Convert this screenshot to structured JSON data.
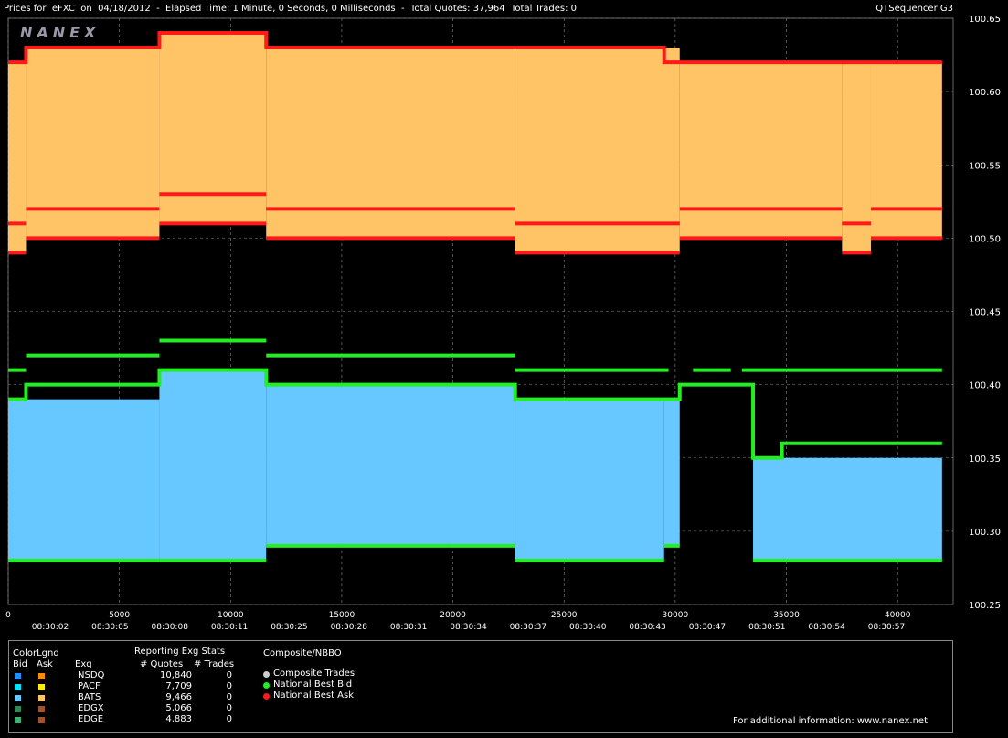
{
  "header": {
    "title": "Prices for  eFXC  on  04/18/2012  -  Elapsed Time: 1 Minute, 0 Seconds, 0 Milliseconds  -  Total Quotes: 37,964  Total Trades: 0",
    "app": "QTSequencer G3"
  },
  "logo": "NANEX",
  "colors": {
    "ask_fill": "#ffc466",
    "bid_fill": "#66c8ff",
    "ask_line": "#ff1a1a",
    "bid_line": "#22ee22",
    "grid": "#888888"
  },
  "chart_data": {
    "type": "line",
    "ylim": [
      100.25,
      100.65
    ],
    "xlim": [
      0,
      42500
    ],
    "y_ticks": [
      "100.25",
      "100.30",
      "100.35",
      "100.40",
      "100.45",
      "100.50",
      "100.55",
      "100.60",
      "100.65"
    ],
    "x_ticks": [
      "0",
      "5000",
      "10000",
      "15000",
      "20000",
      "25000",
      "30000",
      "35000",
      "40000"
    ],
    "time_labels": [
      "08:30:02",
      "08:30:05",
      "08:30:08",
      "08:30:11",
      "08:30:25",
      "08:30:28",
      "08:30:31",
      "08:30:34",
      "08:30:37",
      "08:30:40",
      "08:30:43",
      "08:30:47",
      "08:30:51",
      "08:30:54",
      "08:30:57"
    ],
    "series": [
      {
        "name": "National Best Ask",
        "points": [
          [
            0,
            100.62
          ],
          [
            800,
            100.63
          ],
          [
            6800,
            100.64
          ],
          [
            11600,
            100.63
          ],
          [
            29500,
            100.62
          ],
          [
            42000,
            100.62
          ]
        ]
      },
      {
        "name": "National Best Bid",
        "points": [
          [
            0,
            100.39
          ],
          [
            800,
            100.4
          ],
          [
            6800,
            100.41
          ],
          [
            11600,
            100.4
          ],
          [
            22800,
            100.39
          ],
          [
            30200,
            100.4
          ],
          [
            33500,
            100.35
          ],
          [
            34800,
            100.36
          ],
          [
            42000,
            100.36
          ]
        ]
      }
    ],
    "ask_levels": [
      [
        0,
        800,
        100.51
      ],
      [
        800,
        6800,
        100.52
      ],
      [
        6800,
        11600,
        100.53
      ],
      [
        11600,
        22800,
        100.52
      ],
      [
        22800,
        30200,
        100.51
      ],
      [
        30200,
        37500,
        100.52
      ],
      [
        37500,
        38800,
        100.51
      ],
      [
        38800,
        42000,
        100.52
      ]
    ],
    "ask_low": [
      [
        0,
        800,
        100.49
      ],
      [
        800,
        6800,
        100.5
      ],
      [
        6800,
        11600,
        100.51
      ],
      [
        11600,
        22800,
        100.5
      ],
      [
        22800,
        30200,
        100.49
      ],
      [
        30200,
        37500,
        100.5
      ],
      [
        37500,
        38800,
        100.49
      ],
      [
        38800,
        42000,
        100.5
      ]
    ],
    "bid_high": [
      [
        0,
        800,
        100.41
      ],
      [
        800,
        6800,
        100.42
      ],
      [
        6800,
        11600,
        100.43
      ],
      [
        11600,
        22800,
        100.42
      ],
      [
        22800,
        29700,
        100.41
      ],
      [
        30800,
        32500,
        100.41
      ],
      [
        33000,
        42000,
        100.41
      ]
    ],
    "bid_low": [
      [
        0,
        6800,
        100.28
      ],
      [
        6800,
        11600,
        100.28
      ],
      [
        11600,
        22800,
        100.29
      ],
      [
        22800,
        29500,
        100.28
      ],
      [
        29500,
        30200,
        100.29
      ],
      [
        33500,
        42000,
        100.28
      ]
    ]
  },
  "legend": {
    "color_title": "ColorLgnd",
    "bid": "Bid",
    "ask": "Ask",
    "exq": "Exq",
    "stats_title": "Reporting Exg Stats",
    "quotes": "# Quotes",
    "trades": "# Trades",
    "comp_title": "Composite/NBBO",
    "rows": [
      {
        "ex": "NSDQ",
        "q": "10,840",
        "t": "0",
        "bid": "#1e90ff",
        "ask": "#ff8c00"
      },
      {
        "ex": "PACF",
        "q": "7,709",
        "t": "0",
        "bid": "#00e5ff",
        "ask": "#ffee00"
      },
      {
        "ex": "BATS",
        "q": "9,466",
        "t": "0",
        "bid": "#66c8ff",
        "ask": "#ffc466"
      },
      {
        "ex": "EDGX",
        "q": "5,066",
        "t": "0",
        "bid": "#2e8b57",
        "ask": "#a0522d"
      },
      {
        "ex": "EDGE",
        "q": "4,883",
        "t": "0",
        "bid": "#3cb371",
        "ask": "#a0522d"
      }
    ],
    "composite": [
      "Composite Trades",
      "National Best Bid",
      "National Best Ask"
    ],
    "footer": "For additional information: www.nanex.net"
  }
}
